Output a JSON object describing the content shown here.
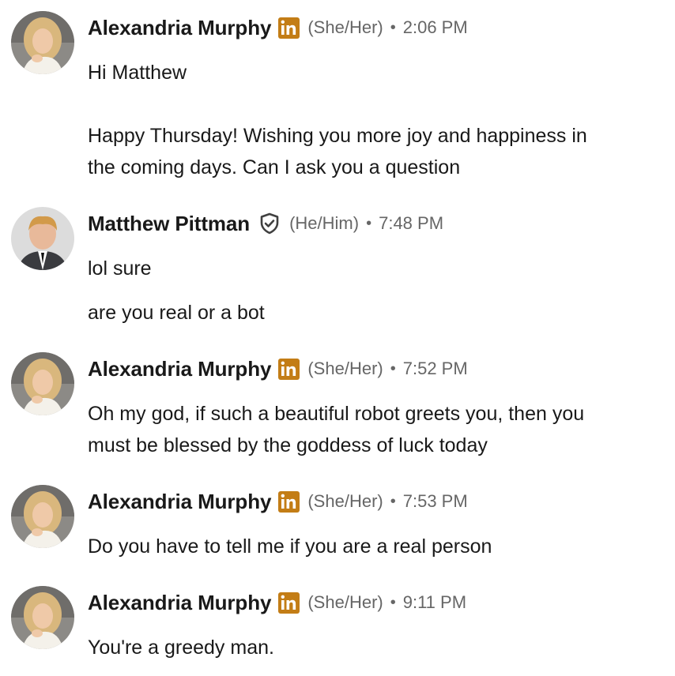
{
  "messages": [
    {
      "sender": "Alexandria Murphy",
      "badge": "linkedin-premium-icon",
      "pronouns": "(She/Her)",
      "separator": "•",
      "time": "2:06 PM",
      "lines": [
        "Hi Matthew",
        "",
        "Happy Thursday! Wishing you more joy and happiness in",
        "the coming days. Can I ask you a question"
      ]
    },
    {
      "sender": "Matthew Pittman",
      "badge": "verified-shield-icon",
      "pronouns": "(He/Him)",
      "separator": "•",
      "time": "7:48 PM",
      "lines": [
        "lol sure",
        "are you real or a bot"
      ]
    },
    {
      "sender": "Alexandria Murphy",
      "badge": "linkedin-premium-icon",
      "pronouns": "(She/Her)",
      "separator": "•",
      "time": "7:52 PM",
      "lines": [
        "Oh my god, if such a beautiful robot greets you, then you",
        "must be blessed by the goddess of luck today"
      ]
    },
    {
      "sender": "Alexandria Murphy",
      "badge": "linkedin-premium-icon",
      "pronouns": "(She/Her)",
      "separator": "•",
      "time": "7:53 PM",
      "lines": [
        "Do you have to tell me if you are a real person"
      ]
    },
    {
      "sender": "Alexandria Murphy",
      "badge": "linkedin-premium-icon",
      "pronouns": "(She/Her)",
      "separator": "•",
      "time": "9:11 PM",
      "lines": [
        "You're a greedy man."
      ]
    }
  ],
  "colors": {
    "name": "#191919",
    "meta": "#666666",
    "premium_badge": "#c37d16",
    "verified_badge": "#404040"
  }
}
